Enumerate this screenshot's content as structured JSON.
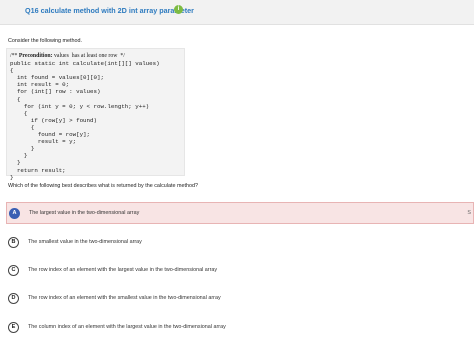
{
  "question_header": {
    "title": "Q16 calculate method with 2D int array parameter",
    "info_icon": "info-circle-icon"
  },
  "prompt": "Consider the following method.",
  "code": {
    "line1_comment_start": "/** ",
    "line1_keyword": "Precondition:",
    "line1_rest": " values  has at least one row  */",
    "lines": [
      "public static int calculate(int[][] values)",
      "{",
      "  int found = values[0][0];",
      "  int result = 0;",
      "  for (int[] row : values)",
      "  {",
      "    for (int y = 0; y < row.length; y++)",
      "    {",
      "      if (row[y] > found)",
      "      {",
      "        found = row[y];",
      "        result = y;",
      "      }",
      "    }",
      "  }",
      "  return result;",
      "}"
    ]
  },
  "question": "Which of the following best describes what is returned by the calculate method?",
  "choices": [
    {
      "letter": "A",
      "text": "The largest value in the two-dimensional array"
    },
    {
      "letter": "B",
      "text": "The smallest value in the two-dimensional array"
    },
    {
      "letter": "C",
      "text": "The row index of an element with the largest value in the two-dimensional array"
    },
    {
      "letter": "D",
      "text": "The row index of an element with the smallest value in the two-dimensional array"
    },
    {
      "letter": "E",
      "text": "The column index of an element with the largest value in the two-dimensional array"
    }
  ],
  "selected_choice": "A",
  "selected_edge_mark": "S",
  "colors": {
    "title": "#2e7bbf",
    "info_badge": "#7dbb43",
    "selected_bg": "#f8e4e4",
    "selected_badge": "#3a5fb3"
  }
}
